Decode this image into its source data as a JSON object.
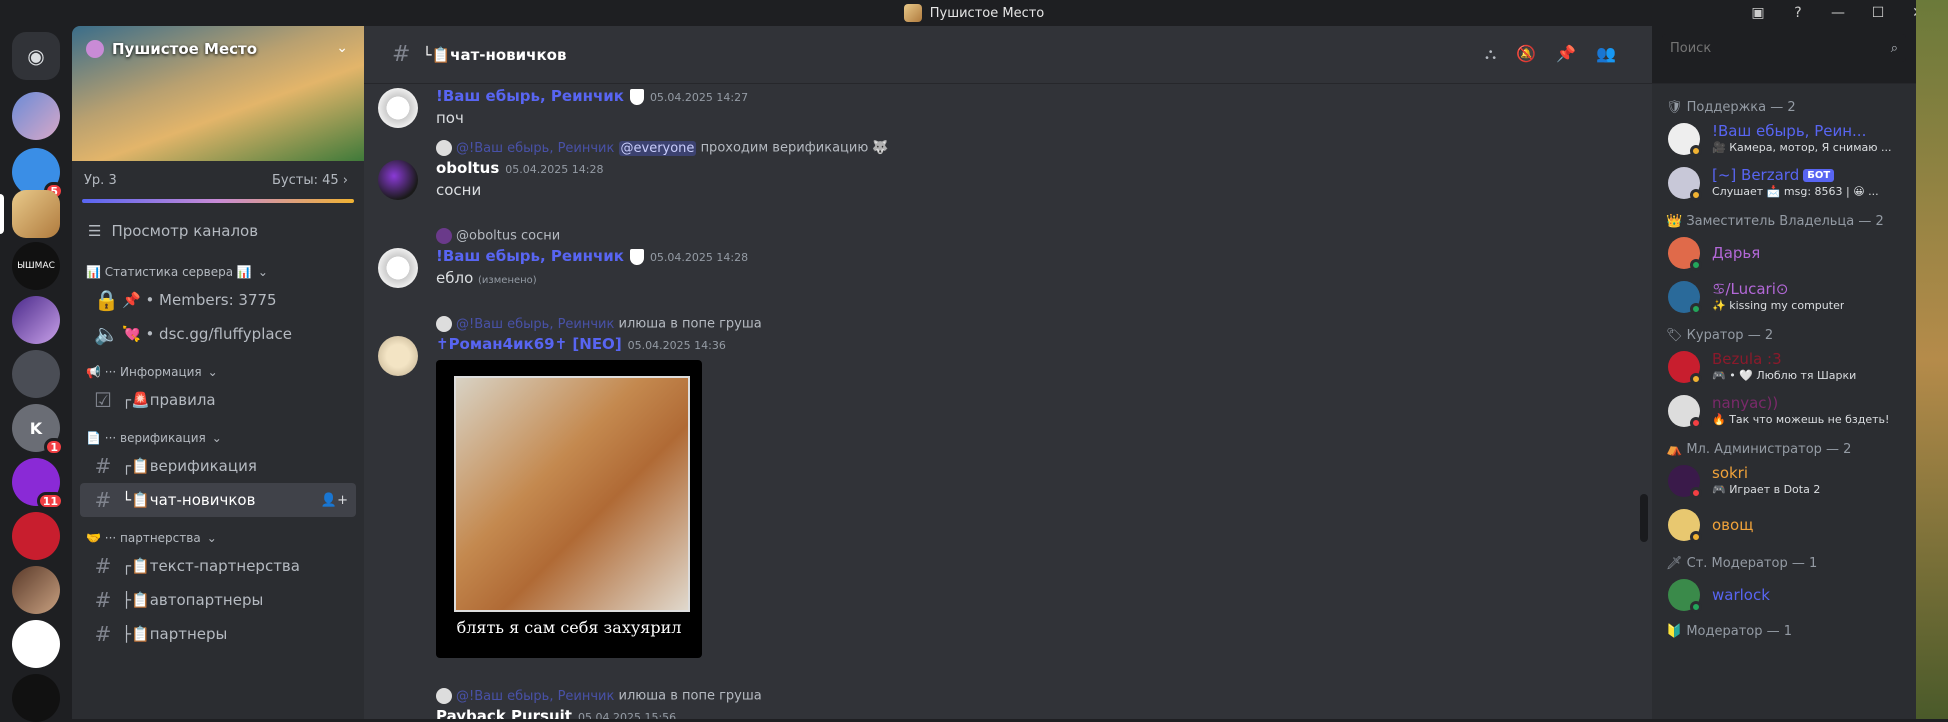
{
  "window": {
    "title": "Пушистое Место"
  },
  "server": {
    "name": "Пушистое Место",
    "level": "Ур. 3",
    "boosts": "Бусты: 45"
  },
  "nav": {
    "browse": "Просмотр каналов"
  },
  "guilds": [
    {
      "name": "discord-home-icon",
      "badge": ""
    },
    {
      "name": "guild-1",
      "badge": ""
    },
    {
      "name": "guild-2",
      "badge": "5"
    },
    {
      "name": "guild-3",
      "badge": ""
    },
    {
      "name": "guild-4",
      "badge": ""
    },
    {
      "name": "guild-5",
      "badge": ""
    },
    {
      "name": "guild-6",
      "badge": ""
    },
    {
      "name": "guild-7",
      "badge": "1"
    },
    {
      "name": "guild-8",
      "badge": "11"
    },
    {
      "name": "guild-9",
      "badge": ""
    },
    {
      "name": "guild-10",
      "badge": ""
    },
    {
      "name": "guild-11",
      "badge": ""
    },
    {
      "name": "guild-12",
      "badge": ""
    },
    {
      "name": "guild-13",
      "badge": ""
    }
  ],
  "guild_text": "ЫШМАС",
  "categories": {
    "stats": "📊 Статистика сервера 📊",
    "info": "📢 ··· Информация",
    "verify": "📄 ··· верификация",
    "partners": "🤝 ··· партнерства"
  },
  "channels": {
    "members": "📌 • Members: 3775",
    "invite": "💘 • dsc.gg/fluffyplace",
    "rules": "┌🚨правила",
    "verification": "┌📋верификация",
    "newbie": "└📋чат-новичков",
    "partner_text": "┌📋текст-партнерства",
    "autopartners": "├📋автопартнеры",
    "partners": "├📋партнеры"
  },
  "header": {
    "channel": "└📋чат-новичков"
  },
  "search": {
    "placeholder": "Поиск"
  },
  "messages": {
    "m1": {
      "user": "!Ваш ебырь, Реинчик",
      "time": "05.04.2025 14:27",
      "text": "поч"
    },
    "m2": {
      "reply_user": "@!Ваш ебырь, Реинчик",
      "reply_mention": "@everyone",
      "reply_text": "проходим верификацию 🐺",
      "user": "oboltus",
      "time": "05.04.2025 14:28",
      "text": "сосни"
    },
    "m3": {
      "reply_user": "@oboltus",
      "reply_text": "сосни",
      "user": "!Ваш ебырь, Реинчик",
      "time": "05.04.2025 14:28",
      "text": "ебло",
      "edited": "(изменено)"
    },
    "m4": {
      "reply_user": "@!Ваш ебырь, Реинчик",
      "reply_text": "илюша в попе груша",
      "user": "✝Роман4ик69✝ [NEO]",
      "time": "05.04.2025 14:36",
      "caption": "блять я сам себя захуярил"
    },
    "m5": {
      "reply_user": "@!Ваш ебырь, Реинчик",
      "reply_text": "илюша в попе груша",
      "user": "Payback Pursuit",
      "time": "05.04.2025 15:56"
    }
  },
  "member_groups": {
    "g1": "Поддержка — 2",
    "g2": "Заместитель Владельца — 2",
    "g3": "Куратор — 2",
    "g4": "Мл. Администратор — 2",
    "g5": "Ст. Модератор — 1",
    "g6": "Модератор — 1"
  },
  "members": {
    "u1": {
      "name": "!Ваш ебырь, Реин...",
      "status": "🎥 Камера, мотор, Я снимаю ...",
      "color": "#5865f2"
    },
    "u2": {
      "name": "[~] Berzard",
      "badge": "БОТ",
      "status": "Слушает 📩 msg: 8563 | 😀 ...",
      "color": "#5865f2"
    },
    "u3": {
      "name": "Дарья",
      "status": "",
      "color": "#b368d8"
    },
    "u4": {
      "name": "♋/Lucari⊙",
      "status": "✨ kissing my computer",
      "color": "#b368d8"
    },
    "u5": {
      "name": "Bezula :3",
      "status": "🎮 • 🤍 Люблю тя Шарки",
      "color": "#8b1a2b"
    },
    "u6": {
      "name": "nanyac))",
      "status": "🔥 Так что можешь не бздеть!",
      "color": "#7a2a6a"
    },
    "u7": {
      "name": "sokri",
      "status": "🎮 Играет в Dota 2",
      "color": "#f0a23a"
    },
    "u8": {
      "name": "овощ",
      "status": "",
      "color": "#f0a23a"
    },
    "u9": {
      "name": "warlock",
      "status": "",
      "color": "#5865f2"
    }
  }
}
